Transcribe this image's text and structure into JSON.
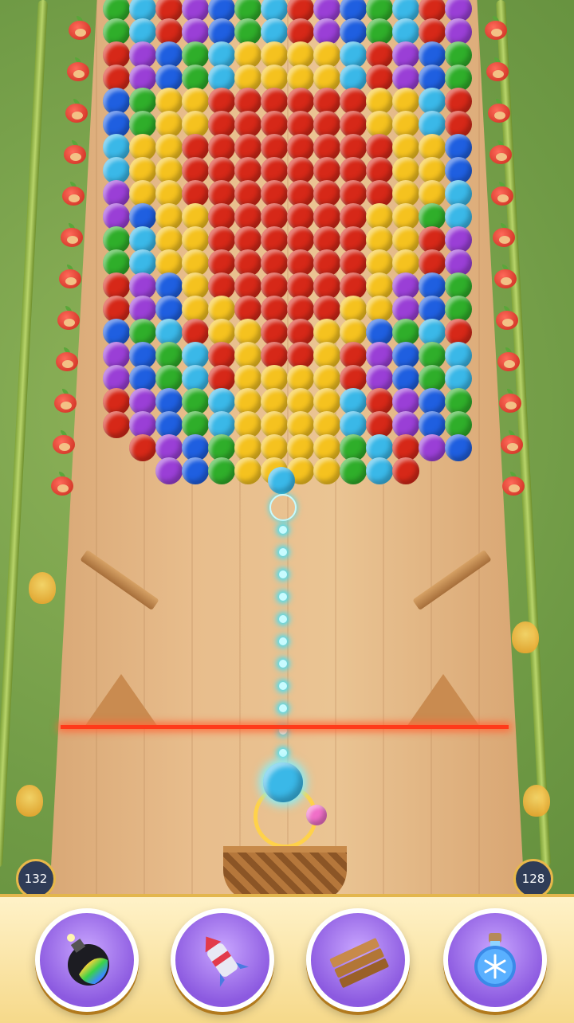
{
  "game": {
    "left_counter": "132",
    "right_counter": "128"
  },
  "colors": {
    "red": "#d62818",
    "yellow": "#f5c21f",
    "purple": "#9a3fd6",
    "blue": "#1f5fe0",
    "green": "#2fae2a",
    "cyan": "#3ab8e8",
    "aim": "#33e0ff",
    "laser": "#ff3a1a"
  },
  "shooter": {
    "current_bubble": "cyan",
    "next_bubble": "pink"
  },
  "boosters": [
    {
      "name": "rainbow-bomb",
      "icon": "rainbow-bomb-icon"
    },
    {
      "name": "rocket",
      "icon": "rocket-icon"
    },
    {
      "name": "wooden-planks",
      "icon": "wood-planks-icon"
    },
    {
      "name": "freeze-potion",
      "icon": "snowflake-potion-icon"
    }
  ]
}
